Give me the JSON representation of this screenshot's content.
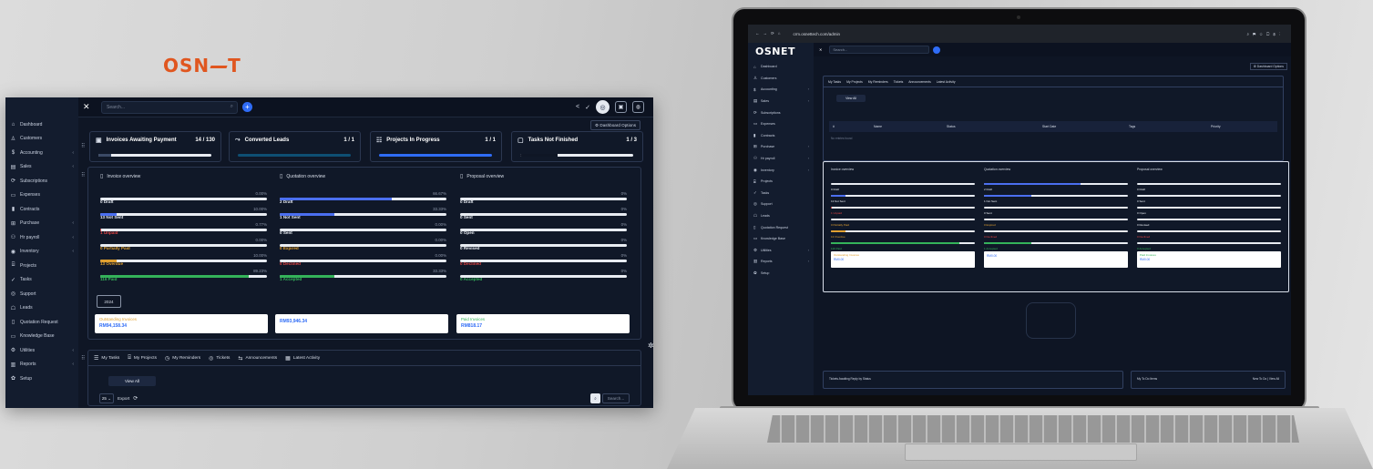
{
  "brand": {
    "logo": "OSNET"
  },
  "sidebar": {
    "items": [
      {
        "icon": "home-icon",
        "glyph": "⌂",
        "label": "Dashboard",
        "arrow": ""
      },
      {
        "icon": "user-icon",
        "glyph": "♙",
        "label": "Customers",
        "arrow": ""
      },
      {
        "icon": "dollar-icon",
        "glyph": "$",
        "label": "Accounting",
        "arrow": "‹"
      },
      {
        "icon": "receipt-icon",
        "glyph": "▤",
        "label": "Sales",
        "arrow": "‹"
      },
      {
        "icon": "refresh-icon",
        "glyph": "⟳",
        "label": "Subscriptions",
        "arrow": ""
      },
      {
        "icon": "file-icon",
        "glyph": "▭",
        "label": "Expenses",
        "arrow": ""
      },
      {
        "icon": "contract-icon",
        "glyph": "▮",
        "label": "Contracts",
        "arrow": ""
      },
      {
        "icon": "cart-icon",
        "glyph": "⊞",
        "label": "Purchase",
        "arrow": "‹"
      },
      {
        "icon": "people-icon",
        "glyph": "⚇",
        "label": "Hr payroll",
        "arrow": "‹"
      },
      {
        "icon": "inventory-icon",
        "glyph": "◉",
        "label": "Inventory",
        "arrow": "‹"
      },
      {
        "icon": "projects-icon",
        "glyph": "⌸",
        "label": "Projects",
        "arrow": ""
      },
      {
        "icon": "check-icon",
        "glyph": "✓",
        "label": "Tasks",
        "arrow": ""
      },
      {
        "icon": "support-icon",
        "glyph": "◎",
        "label": "Support",
        "arrow": ""
      },
      {
        "icon": "leads-icon",
        "glyph": "☖",
        "label": "Leads",
        "arrow": ""
      },
      {
        "icon": "quotation-icon",
        "glyph": "▯",
        "label": "Quotation Request",
        "arrow": ""
      },
      {
        "icon": "book-icon",
        "glyph": "▭",
        "label": "Knowledge Base",
        "arrow": ""
      },
      {
        "icon": "utilities-icon",
        "glyph": "⚙",
        "label": "Utilities",
        "arrow": "‹"
      },
      {
        "icon": "reports-icon",
        "glyph": "▥",
        "label": "Reports",
        "arrow": "‹"
      },
      {
        "icon": "setup-icon",
        "glyph": "✿",
        "label": "Setup",
        "arrow": ""
      }
    ]
  },
  "topbar": {
    "close": "✕",
    "search_placeholder": "Search...",
    "plus": "+",
    "share": "<",
    "check": "✓",
    "logo_circle": "◎",
    "calendar": "▣",
    "bell": "◍"
  },
  "dashboard_options": "⚙ Dashboard Options",
  "stats": [
    {
      "icon": "invoice-icon",
      "glyph": "▣",
      "label": "Invoices Awaiting Payment",
      "value": "14 / 130",
      "fill": 0.11,
      "color": "#3b4a66"
    },
    {
      "icon": "trend-icon",
      "glyph": "⤳",
      "label": "Converted Leads",
      "value": "1 / 1",
      "fill": 1,
      "color": "#0e4f73"
    },
    {
      "icon": "sliders-icon",
      "glyph": "☷",
      "label": "Projects In Progress",
      "value": "1 / 1",
      "fill": 1,
      "color": "#2f6cf6"
    },
    {
      "icon": "task-icon",
      "glyph": "▢",
      "label": "Tasks Not Finished",
      "value": "1 / 3",
      "fill": 0.33,
      "color": "#0f1625"
    }
  ],
  "invoice_overview": {
    "title": "Invoice overview",
    "rows": [
      {
        "label": "0 Draft",
        "pct": "0.00%",
        "fill": 0,
        "color": "#e8ecf2",
        "lcolor": "#e8ecf2"
      },
      {
        "label": "13 Not Sent",
        "pct": "10.00%",
        "fill": 0.1,
        "color": "#4b6ff0",
        "lcolor": "#e8ecf2"
      },
      {
        "label": "1 Unpaid",
        "pct": "0.77%",
        "fill": 0.008,
        "color": "#e04444",
        "lcolor": "#e04444"
      },
      {
        "label": "0 Partially Paid",
        "pct": "0.00%",
        "fill": 0,
        "color": "#e0a030",
        "lcolor": "#e0a030"
      },
      {
        "label": "13 Overdue",
        "pct": "10.00%",
        "fill": 0.1,
        "color": "#e0a030",
        "lcolor": "#e0a030"
      },
      {
        "label": "116 Paid",
        "pct": "89.23%",
        "fill": 0.89,
        "color": "#34b35a",
        "lcolor": "#34b35a"
      }
    ]
  },
  "quotation_overview": {
    "title": "Quotation overview",
    "rows": [
      {
        "label": "2 Draft",
        "pct": "66.67%",
        "fill": 0.67,
        "color": "#4b6ff0",
        "lcolor": "#e8ecf2"
      },
      {
        "label": "1 Not Sent",
        "pct": "33.33%",
        "fill": 0.33,
        "color": "#4b6ff0",
        "lcolor": "#e8ecf2"
      },
      {
        "label": "0 Sent",
        "pct": "0.00%",
        "fill": 0,
        "color": "#4b6ff0",
        "lcolor": "#e8ecf2"
      },
      {
        "label": "0 Expired",
        "pct": "0.00%",
        "fill": 0,
        "color": "#e0a030",
        "lcolor": "#e0a030"
      },
      {
        "label": "0 Declined",
        "pct": "0.00%",
        "fill": 0,
        "color": "#e04444",
        "lcolor": "#e04444"
      },
      {
        "label": "1 Accepted",
        "pct": "33.33%",
        "fill": 0.33,
        "color": "#34b35a",
        "lcolor": "#34b35a"
      }
    ]
  },
  "proposal_overview": {
    "title": "Proposal overview",
    "rows": [
      {
        "label": "0 Draft",
        "pct": "0%",
        "fill": 0,
        "color": "#e8ecf2",
        "lcolor": "#e8ecf2"
      },
      {
        "label": "0 Sent",
        "pct": "0%",
        "fill": 0,
        "color": "#e8ecf2",
        "lcolor": "#e8ecf2"
      },
      {
        "label": "0 Open",
        "pct": "0%",
        "fill": 0,
        "color": "#e8ecf2",
        "lcolor": "#e8ecf2"
      },
      {
        "label": "0 Revised",
        "pct": "0%",
        "fill": 0,
        "color": "#e8ecf2",
        "lcolor": "#e8ecf2"
      },
      {
        "label": "0 Declined",
        "pct": "0%",
        "fill": 0,
        "color": "#e04444",
        "lcolor": "#e04444"
      },
      {
        "label": "0 Accepted",
        "pct": "0%",
        "fill": 0,
        "color": "#34b35a",
        "lcolor": "#34b35a"
      }
    ]
  },
  "year": "2024",
  "totals": [
    {
      "label": "Outstanding Invoices",
      "value": "RM94,158.34",
      "lcolor": "#e0a030"
    },
    {
      "label": "",
      "value": "RM93,946.34",
      "lcolor": "#e0a030"
    },
    {
      "label": "Paid Invoices",
      "value": "RM818.17",
      "lcolor": "#34b35a"
    }
  ],
  "tabs": [
    {
      "icon": "tasks-icon",
      "glyph": "☰",
      "label": "My Tasks"
    },
    {
      "icon": "projects-icon",
      "glyph": "⌸",
      "label": "My Projects"
    },
    {
      "icon": "clock-icon",
      "glyph": "◷",
      "label": "My Reminders"
    },
    {
      "icon": "ticket-icon",
      "glyph": "◎",
      "label": "Tickets"
    },
    {
      "icon": "announce-icon",
      "glyph": "⇆",
      "label": "Announcements"
    },
    {
      "icon": "activity-icon",
      "glyph": "▦",
      "label": "Latest Activity"
    }
  ],
  "view_all": "View All",
  "page_size": "25",
  "export": "Export",
  "search_small": "Search...",
  "laptop": {
    "url": "crm.osnettech.com/admin",
    "table_headers": [
      "#",
      "Name",
      "Status",
      "Start Date",
      "Tags",
      "Priority"
    ],
    "empty_text": "No entries found",
    "bottom_left": "Tickets Awaiting Reply by Status",
    "bottom_right_title": "My To Do Items",
    "bottom_right_links": "New To Do | View All",
    "outstanding": "RM0.00",
    "outstanding_label": "Outstanding Invoices",
    "paid_label": "Paid Invoices"
  }
}
